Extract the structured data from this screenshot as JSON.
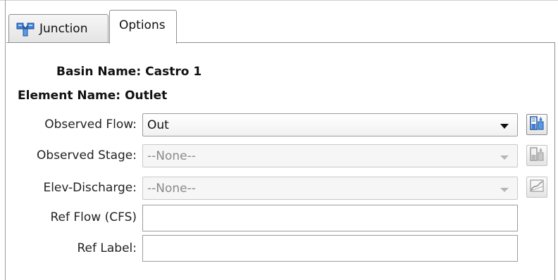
{
  "tabs": [
    {
      "label": "Junction",
      "icon": "junction-icon",
      "active": false
    },
    {
      "label": "Options",
      "active": true
    }
  ],
  "info": {
    "basin_name_label": "Basin Name:",
    "basin_name_value": "Castro 1",
    "element_name_label": "Element Name:",
    "element_name_value": "Outlet"
  },
  "fields": {
    "observed_flow": {
      "label": "Observed Flow:",
      "value": "Out",
      "enabled": true,
      "icon": "flow-gage-icon"
    },
    "observed_stage": {
      "label": "Observed Stage:",
      "value": "--None--",
      "enabled": false,
      "icon": "stage-gage-icon"
    },
    "elev_discharge": {
      "label": "Elev-Discharge:",
      "value": "--None--",
      "enabled": false,
      "icon": "curve-chart-icon"
    },
    "ref_flow": {
      "label": "Ref Flow (CFS)",
      "value": ""
    },
    "ref_label": {
      "label": "Ref Label:",
      "value": ""
    }
  },
  "colors": {
    "accent_blue": "#2f6fd0",
    "border": "#8f8f8f",
    "disabled_text": "#8a8a8a"
  }
}
